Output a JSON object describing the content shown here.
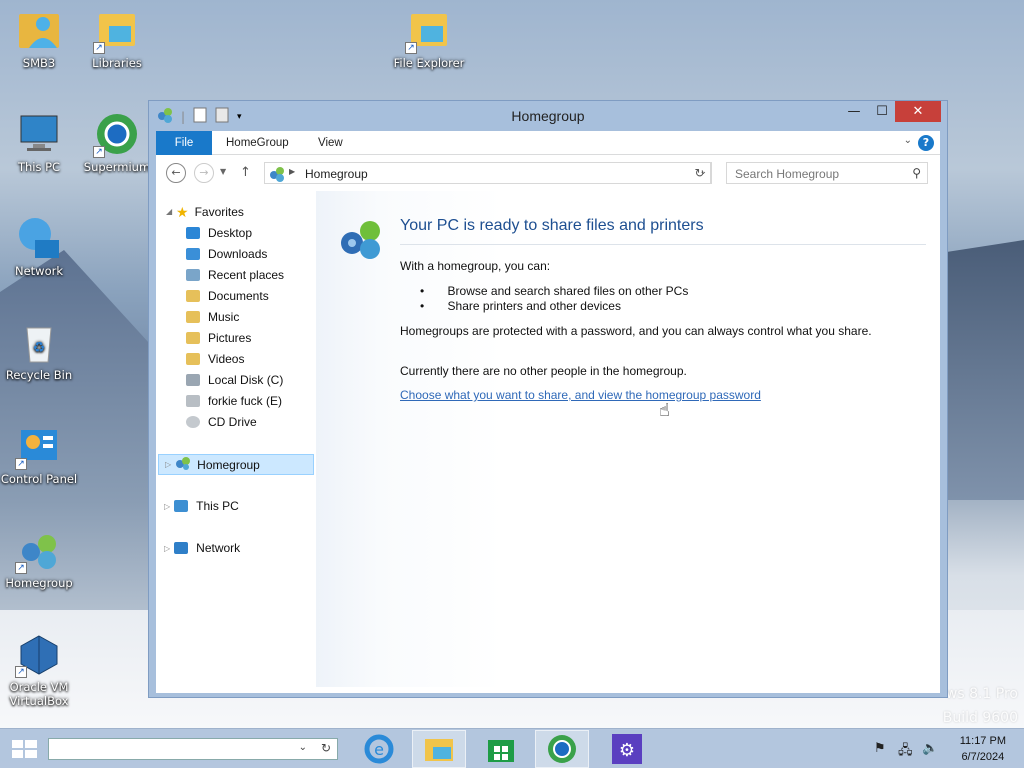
{
  "desktop": {
    "icons": [
      {
        "label": "SMB3"
      },
      {
        "label": "Libraries"
      },
      {
        "label": "File Explorer"
      },
      {
        "label": "This PC"
      },
      {
        "label": "Supermium"
      },
      {
        "label": "Network"
      },
      {
        "label": "Recycle Bin"
      },
      {
        "label": "Control Panel"
      },
      {
        "label": "Homegroup"
      },
      {
        "label": "Oracle VM VirtualBox"
      }
    ],
    "watermark": {
      "line1": "ws 8.1 Pro",
      "line2": "Build 9600"
    }
  },
  "window": {
    "title": "Homegroup",
    "ribbon_tabs": [
      "File",
      "HomeGroup",
      "View"
    ],
    "address": "Homegroup",
    "search_placeholder": "Search Homegroup",
    "nav": {
      "favorites": "Favorites",
      "items": [
        "Desktop",
        "Downloads",
        "Recent places",
        "Documents",
        "Music",
        "Pictures",
        "Videos",
        "Local Disk (C)",
        "forkie fuck (E)",
        "CD Drive"
      ],
      "homegroup": "Homegroup",
      "thispc": "This PC",
      "network": "Network"
    },
    "content": {
      "heading": "Your PC is ready to share files and printers",
      "intro": "With a homegroup, you can:",
      "bullets": [
        "Browse and search shared files on other PCs",
        "Share printers and other devices"
      ],
      "protected": "Homegroups are protected with a password, and you can always control what you share.",
      "no_people": "Currently there are no other people in the homegroup.",
      "link": "Choose what you want to share, and view the homegroup password"
    }
  },
  "taskbar": {
    "time": "11:17 PM",
    "date": "6/7/2024"
  },
  "colors": {
    "accent": "#1979ca",
    "link": "#2f69b8",
    "close": "#c7403a"
  }
}
